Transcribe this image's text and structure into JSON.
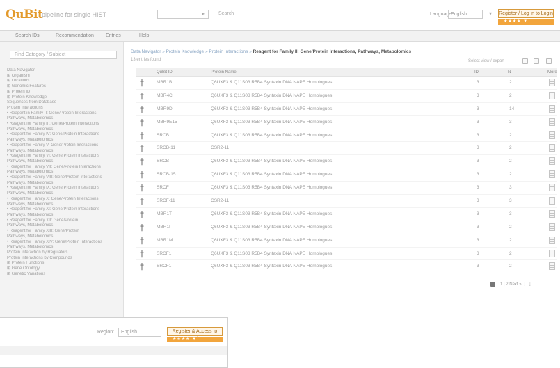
{
  "header": {
    "logo": "QuBit",
    "slogan": "pipeline for single HIST",
    "search_button": "▸",
    "search_label": "Search",
    "language_label": "Language:",
    "language_value": "English",
    "language_sep": "▾",
    "login_label": "Register / Log in to Login",
    "orange_bar": "★★★★  ▼"
  },
  "menu": [
    "Search IDs",
    "Recommendation",
    "Entries",
    "Help"
  ],
  "sidebar": {
    "search_placeholder": "Find Category / Subject",
    "tree": [
      "Data Navigator",
      "⊞ Organism",
      "⊞ Locations",
      "⊞ Genomic Features",
      "⊞ Protein ID",
      "⊞ Protein Knowledge",
      "  Sequences from Database",
      "  Protein Interactions",
      "    • Reagent in Family II: Gene/Protein Interactions",
      "       Pathways, Metabolomics",
      "    • Reagent for Family III: Gene/Protein Interactions",
      "       Pathways, Metabolomics",
      "    • Reagent for Family IV: Gene/Protein Interactions",
      "       Pathways, Metabolomics",
      "    • Reagent for Family V: Gene/Protein Interactions",
      "       Pathways, Metabolomics",
      "    • Reagent for Family VI: Gene/Protein Interactions",
      "       Pathways, Metabolomics",
      "    • Reagent for Family VII: Gene/Protein Interactions",
      "       Pathways, Metabolomics",
      "    • Reagent for Family VIII: Gene/Protein Interactions",
      "       Pathways, Metabolomics",
      "    • Reagent for Family IX: Gene/Protein Interactions",
      "       Pathways, Metabolomics",
      "    • Reagent for Family X: Gene/Protein Interactions",
      "       Pathways, Metabolomics",
      "    • Reagent for Family XI: Gene/Protein Interactions",
      "       Pathways, Metabolomics",
      "    • Reagent for Family XII: Gene/Protein",
      "       Pathways, Metabolomics",
      "    • Reagent for Family XIII: Gene/Protein",
      "       Pathways, Metabolomics",
      "    • Reagent for Family XIV: Gene/Protein Interactions",
      "       Pathways, Metabolomics",
      "  Protein Interaction by Regulators",
      "  Protein Interactions by Compounds",
      "⊞ Protein Functions",
      "⊞ Gene Ontology",
      "⊞ Genetic Variations"
    ]
  },
  "content": {
    "breadcrumb_path": "Data Navigator » Protein Knowledge » Protein Interactions »",
    "breadcrumb_current": "Reagent for Family II: Gene/Protein Interactions, Pathways, Metabolomics",
    "subline": "13 entries found",
    "view_options": "Select view / export",
    "columns": [
      "",
      "QuBit ID",
      "Protein Name",
      "ID",
      "N",
      "More"
    ],
    "rows": [
      {
        "glyph": "†",
        "id": "MBR1B",
        "name": "Q6UXF3 & Q11S03 R5B4 Syntaxin DNA NAPE Homologues",
        "a": "3",
        "b": "2"
      },
      {
        "glyph": "†",
        "id": "MBR4C",
        "name": "Q6UXF3 & Q11S03 R5B4 Syntaxin DNA NAPE Homologues",
        "a": "3",
        "b": "2"
      },
      {
        "glyph": "†",
        "id": "MBR9D",
        "name": "Q6UXF3 & Q11S03 R5B4 Syntaxin DNA NAPE Homologues",
        "a": "3",
        "b": "14"
      },
      {
        "glyph": "†",
        "id": "MBR9E15",
        "name": "Q6UXF3 & Q11S03 R5B4 Syntaxin DNA NAPE Homologues",
        "a": "3",
        "b": "3"
      },
      {
        "glyph": "†",
        "id": "SRCB",
        "name": "Q6UXF3 & Q11S03 R5B4 Syntaxin DNA NAPE Homologues",
        "a": "3",
        "b": "2"
      },
      {
        "glyph": "†",
        "id": "SRCB-11",
        "name": "CSR2-11",
        "a": "3",
        "b": "2"
      },
      {
        "glyph": "†",
        "id": "SRCB",
        "name": "Q6UXF3 & Q11S03 R5B4 Syntaxin DNA NAPE Homologues",
        "a": "3",
        "b": "2"
      },
      {
        "glyph": "†",
        "id": "SRCB-15",
        "name": "Q6UXF3 & Q11S03 R5B4 Syntaxin DNA NAPE Homologues",
        "a": "3",
        "b": "2"
      },
      {
        "glyph": "†",
        "id": "SRCF",
        "name": "Q6UXF3 & Q11S03 R5B4 Syntaxin DNA NAPE Homologues",
        "a": "3",
        "b": "3"
      },
      {
        "glyph": "†",
        "id": "SRCF-11",
        "name": "CSR2-11",
        "a": "3",
        "b": "3"
      },
      {
        "glyph": "†",
        "id": "MBR1T",
        "name": "Q6UXF3 & Q11S03 R5B4 Syntaxin DNA NAPE Homologues",
        "a": "3",
        "b": "3"
      },
      {
        "glyph": "†",
        "id": "MBR1I",
        "name": "Q6UXF3 & Q11S03 R5B4 Syntaxin DNA NAPE Homologues",
        "a": "3",
        "b": "2"
      },
      {
        "glyph": "†",
        "id": "MBR1M",
        "name": "Q6UXF3 & Q11S03 R5B4 Syntaxin DNA NAPE Homologues",
        "a": "3",
        "b": "2"
      },
      {
        "glyph": "†",
        "id": "SRCF1",
        "name": "Q6UXF3 & Q11S03 R5B4 Syntaxin DNA NAPE Homologues",
        "a": "3",
        "b": "2"
      },
      {
        "glyph": "†",
        "id": "SRCF1",
        "name": "Q6UXF3 & Q11S03 R5B4 Syntaxin DNA NAPE Homologues",
        "a": "3",
        "b": "2"
      }
    ],
    "pager": "1 | 2  Next »  ⋮ ⋮"
  },
  "window2": {
    "language_label": "Region:",
    "language_value": "English",
    "language_sep": "▾",
    "login_label": "Register & Access to Login",
    "orange_bar": "★★★★  ▼"
  }
}
